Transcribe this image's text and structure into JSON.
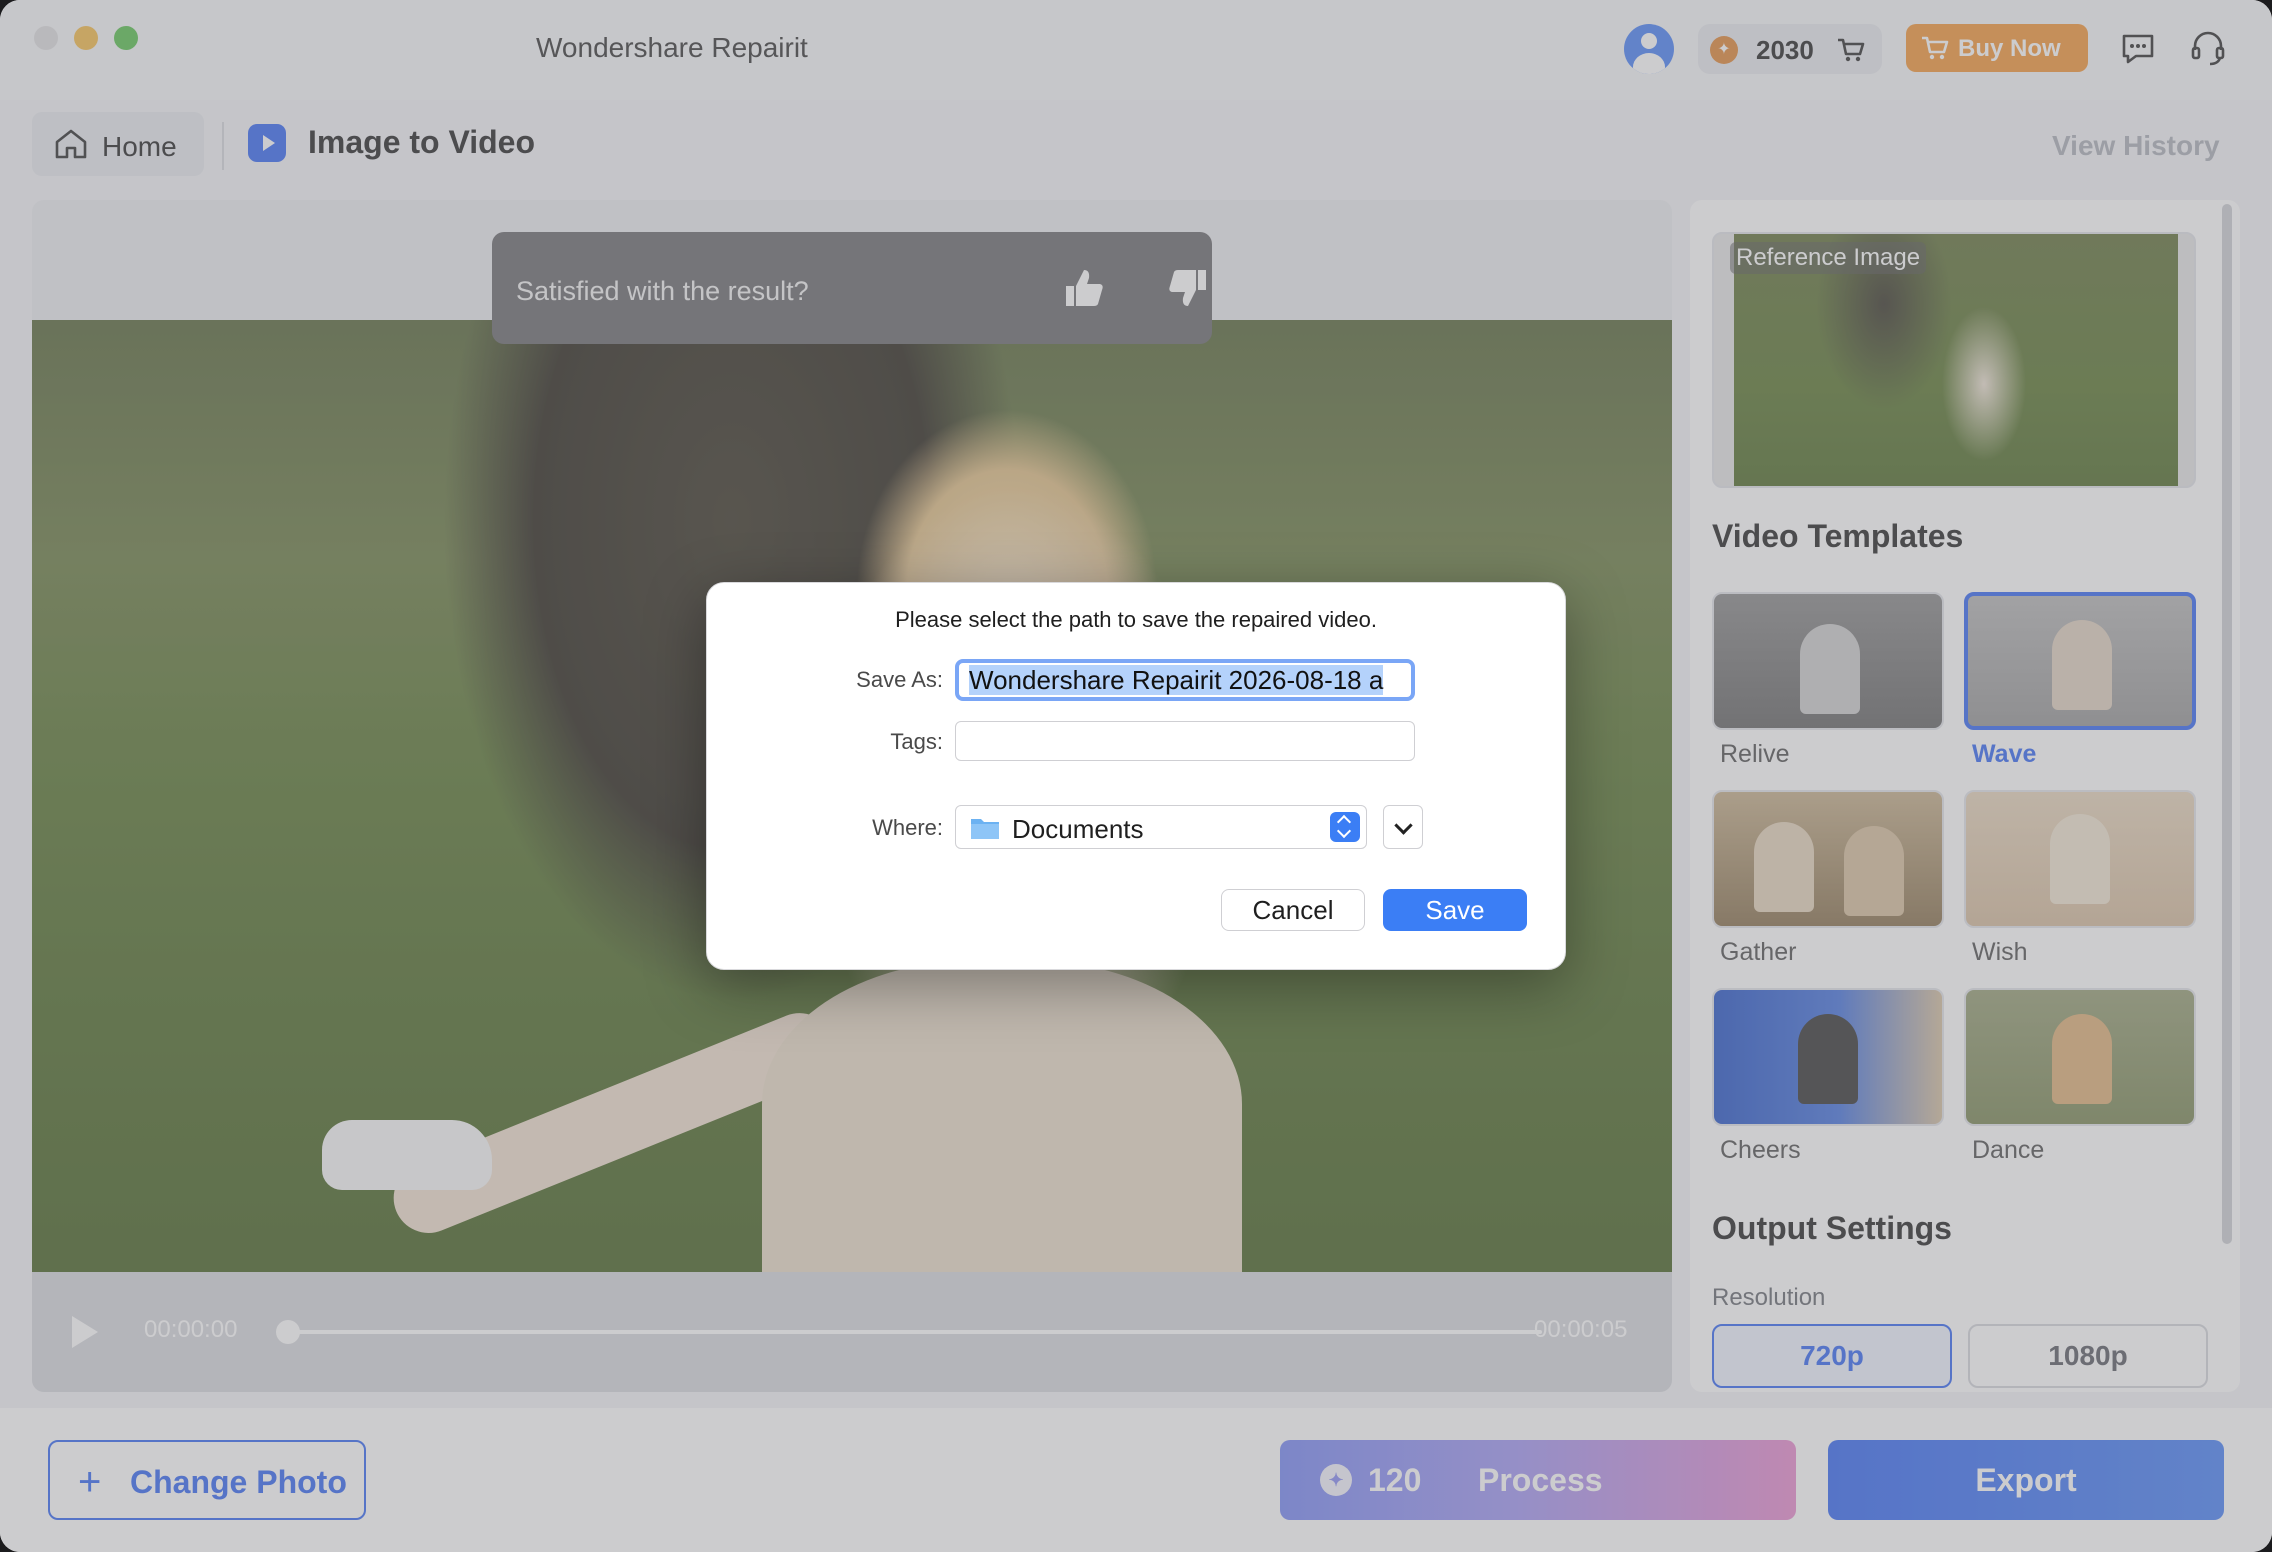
{
  "window": {
    "title": "Wondershare Repairit"
  },
  "header": {
    "credits": "2030",
    "buy_now_label": "Buy Now",
    "icons": [
      "user-avatar-icon",
      "coin-icon",
      "cart-icon",
      "chat-icon",
      "headset-icon"
    ]
  },
  "nav": {
    "home_label": "Home",
    "feature_title": "Image to Video",
    "view_history_label": "View History"
  },
  "preview": {
    "feedback_question": "Satisfied with the result?",
    "time_start": "00:00:00",
    "time_end": "00:00:05",
    "progress": 0
  },
  "side": {
    "reference_label": "Reference Image",
    "video_templates_title": "Video Templates",
    "templates": [
      {
        "label": "Relive",
        "selected": false
      },
      {
        "label": "Wave",
        "selected": true
      },
      {
        "label": "Gather",
        "selected": false
      },
      {
        "label": "Wish",
        "selected": false
      },
      {
        "label": "Cheers",
        "selected": false
      },
      {
        "label": "Dance",
        "selected": false
      }
    ],
    "output_settings_title": "Output Settings",
    "resolution_label": "Resolution",
    "resolutions": [
      "720p",
      "1080p"
    ],
    "selected_resolution": "720p"
  },
  "bottom": {
    "change_photo_label": "Change Photo",
    "process_cost": "120",
    "process_label": "Process",
    "export_label": "Export"
  },
  "dialog": {
    "message": "Please select the path to save the repaired video.",
    "save_as_label": "Save As:",
    "save_as_value": "Wondershare Repairit 2026-08-18 a",
    "tags_label": "Tags:",
    "tags_value": "",
    "where_label": "Where:",
    "where_value": "Documents",
    "cancel_label": "Cancel",
    "save_label": "Save"
  },
  "colors": {
    "accent": "#3b6df4",
    "buy_now": "#f39a3e",
    "dialog_button": "#3b7ef5"
  }
}
